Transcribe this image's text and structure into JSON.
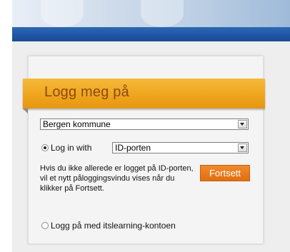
{
  "header": {
    "title": "Logg meg på"
  },
  "organization_select": {
    "value": "Bergen kommune"
  },
  "login_method": {
    "radio_label": "Log in with",
    "select_value": "ID-porten"
  },
  "info_text": "Hvis du ikke allerede er logget på ID-porten, vil et nytt påloggingsvindu vises når du klikker på Fortsett.",
  "continue_button": "Fortsett",
  "alt_login": {
    "radio_label": "Logg på med itslearning-kontoen"
  },
  "colors": {
    "header_orange": "#f0a51d",
    "title_brown": "#8a4a12",
    "button_orange": "#e87a1e",
    "banner_blue": "#1e55a3"
  }
}
